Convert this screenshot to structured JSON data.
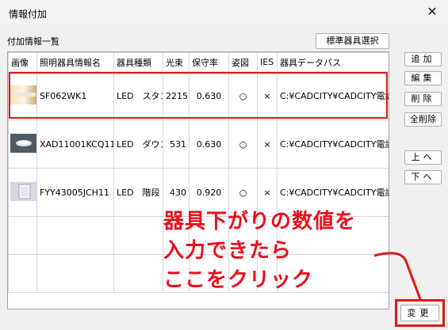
{
  "window": {
    "title": "情報付加",
    "close_glyph": "✕"
  },
  "group_label": "付加情報一覧",
  "buttons": {
    "standard_select": "標準器具選択",
    "add": "追加",
    "edit": "編集",
    "delete": "削除",
    "delete_all": "全削除",
    "up": "上へ",
    "down": "下へ",
    "change": "変更"
  },
  "table": {
    "columns": [
      "画像",
      "照明器具情報名",
      "器具種類",
      "光束",
      "保守率",
      "姿図",
      "IES",
      "器具データパス"
    ],
    "rows": [
      {
        "name": "SF062WK1",
        "type": "LED　スタン",
        "flux": "2215",
        "maintenance": "0.630",
        "figure": "○",
        "ies": "×",
        "path": "C:¥CADCITY¥CADCITY電設",
        "thumb": "wall-light-icon"
      },
      {
        "name": "XAD11001KCQ11",
        "type": "LED　ダウン",
        "flux": "531",
        "maintenance": "0.630",
        "figure": "○",
        "ies": "×",
        "path": "C:¥CADCITY¥CADCITY電設",
        "thumb": "downlight-icon"
      },
      {
        "name": "FYY43005JCH11",
        "type": "LED　階段",
        "flux": "430",
        "maintenance": "0.920",
        "figure": "○",
        "ies": "×",
        "path": "C:¥CADCITY¥CADCITY電設",
        "thumb": "stair-light-icon"
      }
    ]
  },
  "annotation": {
    "line1": "器具下がりの数値を",
    "line2": "入力できたら",
    "line3": "ここをクリック",
    "color": "#e8101e"
  },
  "colors": {
    "highlight": "#e01818",
    "background": "#f0f0f0"
  }
}
